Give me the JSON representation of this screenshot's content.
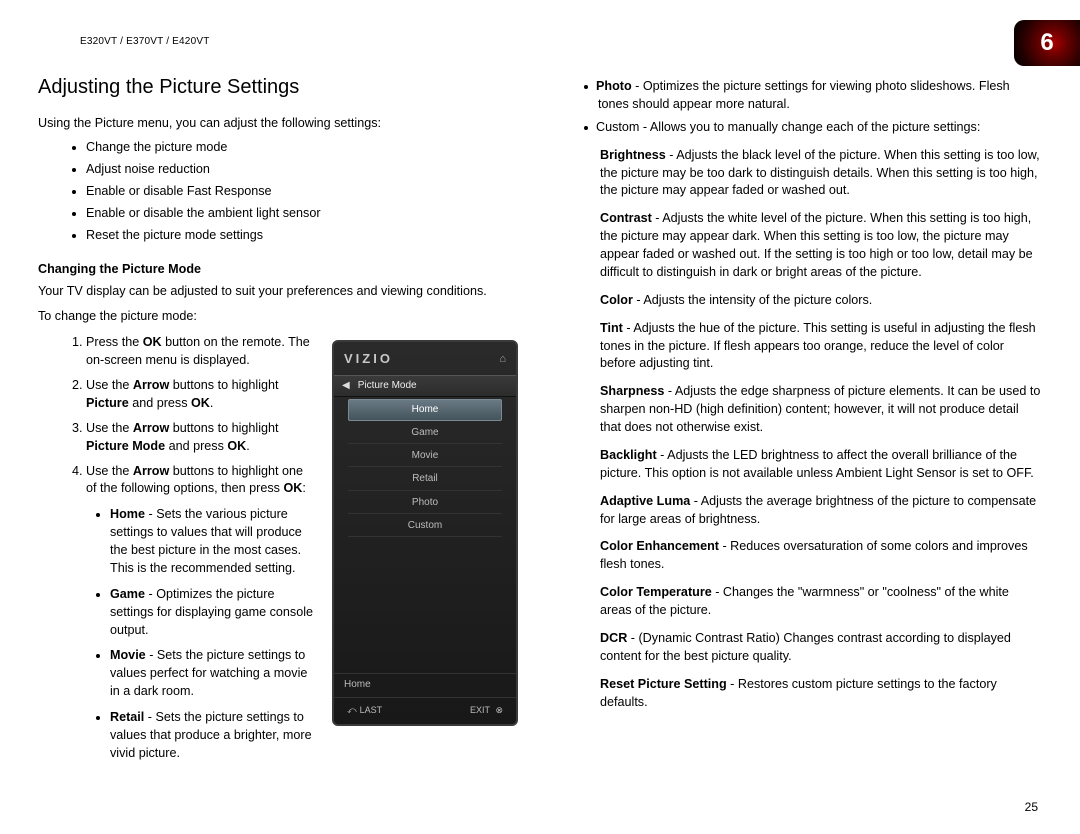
{
  "header": {
    "model": "E320VT / E370VT / E420VT",
    "chapter_number": "6"
  },
  "page_number": "25",
  "left": {
    "title": "Adjusting the Picture Settings",
    "intro": "Using the Picture menu, you can adjust the following settings:",
    "bullets": [
      "Change the picture mode",
      "Adjust noise reduction",
      "Enable or disable Fast Response",
      "Enable or disable the ambient light sensor",
      "Reset the picture mode settings"
    ],
    "sub_head": "Changing the Picture Mode",
    "sub_intro": "Your TV display can be adjusted to suit your preferences and viewing conditions.",
    "steps_intro": "To change the picture mode:",
    "steps": {
      "s1_a": "Press the ",
      "s1_b": "OK",
      "s1_c": " button on the remote. The on-screen menu is displayed.",
      "s2_a": "Use the ",
      "s2_b": "Arrow",
      "s2_c": " buttons to highlight ",
      "s2_d": "Picture",
      "s2_e": " and press ",
      "s2_f": "OK",
      "s2_g": ".",
      "s3_a": "Use the ",
      "s3_b": "Arrow",
      "s3_c": " buttons to highlight ",
      "s3_d": "Picture Mode",
      "s3_e": " and press ",
      "s3_f": "OK",
      "s3_g": ".",
      "s4_a": "Use the ",
      "s4_b": "Arrow",
      "s4_c": " buttons to highlight one of the following options, then press ",
      "s4_d": "OK",
      "s4_e": ":"
    },
    "modes": [
      {
        "name": "Home",
        "desc": " - Sets the various picture settings to values that will produce the best picture in the most cases. This is the recommended setting."
      },
      {
        "name": "Game",
        "desc": " - Optimizes the picture settings for displaying game console output."
      },
      {
        "name": "Movie",
        "desc": " - Sets the picture settings to values perfect for watching a movie in a dark room."
      },
      {
        "name": "Retail",
        "desc": " - Sets the picture settings to values that produce a brighter, more vivid picture."
      }
    ]
  },
  "right": {
    "top_items": [
      {
        "name": "Photo",
        "desc": " - Optimizes the picture settings for viewing photo slideshows. Flesh tones should appear more natural."
      },
      {
        "name": "Custom",
        "desc": " - Allows you to manually change each of the picture settings:",
        "plain_name": true
      }
    ],
    "custom_settings": [
      {
        "name": "Brightness",
        "desc": " - Adjusts the black level of the picture. When this setting is too low, the picture may be too dark to distinguish details. When this setting is too high, the picture may appear faded or washed out."
      },
      {
        "name": "Contrast",
        "desc": " - Adjusts the white level of the picture. When this setting is too high, the picture may appear dark. When this setting is too low, the picture may appear faded or washed out. If the setting is too high or too low, detail may be difficult to distinguish in dark or bright areas of the picture."
      },
      {
        "name": "Color",
        "desc": " - Adjusts the intensity of the picture colors."
      },
      {
        "name": "Tint",
        "desc": " - Adjusts the hue of the picture. This setting is useful in adjusting the flesh tones in the picture. If flesh appears too orange, reduce the level of color before adjusting tint."
      },
      {
        "name": "Sharpness",
        "desc": " - Adjusts the edge sharpness of picture elements. It can be used to sharpen non-HD (high definition) content; however, it will not produce detail that does not otherwise exist."
      },
      {
        "name": "Backlight",
        "desc": " - Adjusts the LED brightness to affect the overall brilliance of the picture. This option is not available unless Ambient Light Sensor is set to OFF."
      },
      {
        "name": "Adaptive Luma",
        "desc": " - Adjusts the average brightness of the picture to compensate for large areas of brightness."
      },
      {
        "name": "Color Enhancement",
        "desc": " - Reduces oversaturation of some colors and improves flesh tones."
      },
      {
        "name": "Color Temperature",
        "desc": " - Changes the \"warmness\" or \"coolness\" of the white areas of the picture."
      },
      {
        "name": "DCR",
        "desc": " - (Dynamic Contrast Ratio) Changes contrast according to displayed content for the best picture quality."
      },
      {
        "name": "Reset Picture Setting",
        "desc": " - Restores custom picture settings to the factory defaults."
      }
    ]
  },
  "osd": {
    "brand": "VIZIO",
    "title": "Picture Mode",
    "items": [
      "Home",
      "Game",
      "Movie",
      "Retail",
      "Photo",
      "Custom"
    ],
    "selected_index": 0,
    "status": "Home",
    "bottom_left": "LAST",
    "bottom_right": "EXIT"
  }
}
